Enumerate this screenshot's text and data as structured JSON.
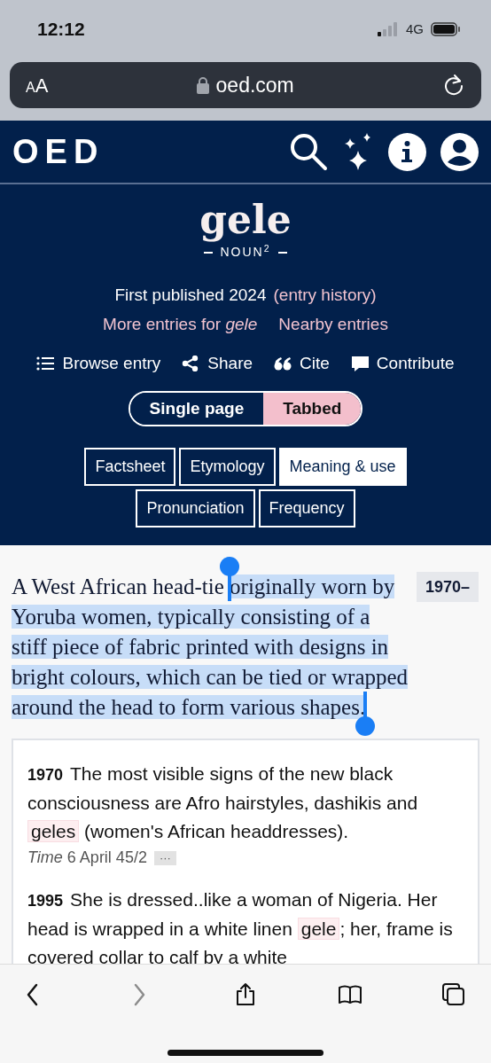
{
  "status_bar": {
    "time": "12:12",
    "network": "4G"
  },
  "address_bar": {
    "text_size_button": "AA",
    "url": "oed.com"
  },
  "site_header": {
    "logo": "OED"
  },
  "entry": {
    "headword": "gele",
    "part_of_speech": "NOUN",
    "homonym": "2",
    "first_published": "First published 2024",
    "entry_history": "(entry history)",
    "links": [
      "More entries for *gele*",
      "Nearby entries"
    ]
  },
  "actions": [
    {
      "label": "Browse entry",
      "kind": "list"
    },
    {
      "label": "Share",
      "kind": "share"
    },
    {
      "label": "Cite",
      "kind": "quote"
    },
    {
      "label": "Contribute",
      "kind": "comment"
    }
  ],
  "view_toggle": [
    {
      "label": "Single page",
      "selected": false
    },
    {
      "label": "Tabbed",
      "selected": true
    }
  ],
  "tabs": [
    [
      {
        "label": "Factsheet",
        "selected": false
      },
      {
        "label": "Etymology",
        "selected": false
      },
      {
        "label": "Meaning & use",
        "selected": true
      }
    ],
    [
      {
        "label": "Pronunciation",
        "selected": false
      },
      {
        "label": "Frequency",
        "selected": false
      }
    ]
  ],
  "definition": {
    "text_before": "A West African head-tie ",
    "selected_text": "originally worn by Yoruba women, typically consisting of a stiff piece of fabric printed with designs in bright colours, which can be tied or wrapped around the head to form various shapes.",
    "date_range": "1970–"
  },
  "quotations": [
    {
      "year": "1970",
      "segments": [
        {
          "text": "The most visible signs of the new black consciousness are Afro hairstyles, dashikis and ",
          "highlight": false
        },
        {
          "text": "geles",
          "highlight": true
        },
        {
          "text": " (women's African headdresses).",
          "highlight": false
        }
      ],
      "source": "*Time* 6 April 45/2",
      "more": "···"
    },
    {
      "year": "1995",
      "segments": [
        {
          "text": "She is dressed..like a woman of Nigeria. Her head is wrapped in a white linen ",
          "highlight": false
        },
        {
          "text": "gele",
          "highlight": true
        },
        {
          "text": ";",
          "highlight": false
        },
        {
          "text": " her, frame is covered collar to calf by a white",
          "highlight": false
        }
      ]
    }
  ],
  "toolbar": [
    {
      "kind": "back",
      "disabled": false
    },
    {
      "kind": "forward",
      "disabled": true
    },
    {
      "kind": "share",
      "disabled": false
    },
    {
      "kind": "bookmarks",
      "disabled": false
    },
    {
      "kind": "tabs",
      "disabled": false
    }
  ]
}
